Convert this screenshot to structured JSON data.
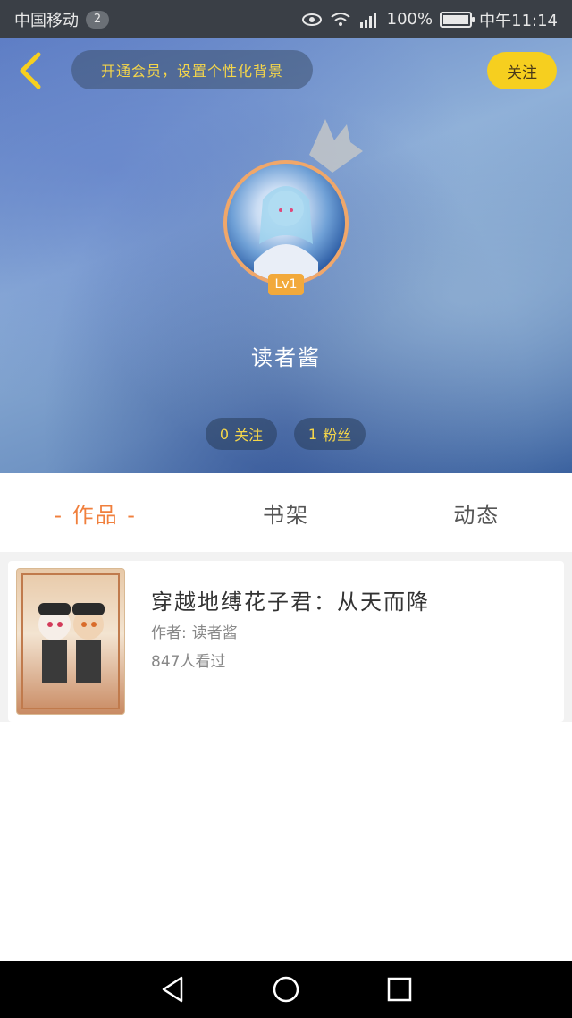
{
  "status_bar": {
    "carrier": "中国移动",
    "sim_badge": "2",
    "battery_level": "100%",
    "time": "中午11:14",
    "icons": [
      "eye-icon",
      "wifi-icon",
      "signal-icon",
      "battery-icon"
    ]
  },
  "header": {
    "back_icon": "chevron-left-icon",
    "vip_prompt": "开通会员，设置个性化背景",
    "follow_label": "关注",
    "crown_icon": "crown-icon",
    "level_badge": "Lv1",
    "username": "读者酱",
    "following_count": "0",
    "following_label": "关注",
    "fans_count": "1",
    "fans_label": "粉丝"
  },
  "tabs": [
    {
      "label": "- 作品 -",
      "active": true
    },
    {
      "label": "书架",
      "active": false
    },
    {
      "label": "动态",
      "active": false
    }
  ],
  "works": [
    {
      "title": "穿越地缚花子君：从天而降",
      "author_label": "作者:",
      "author": "读者酱",
      "views": "847人看过"
    }
  ],
  "colors": {
    "accent_orange": "#f07f3c",
    "accent_yellow": "#f6cf1f",
    "pill_text": "#f5d64a"
  },
  "nav": [
    "back-triangle-icon",
    "home-circle-icon",
    "recent-square-icon"
  ]
}
